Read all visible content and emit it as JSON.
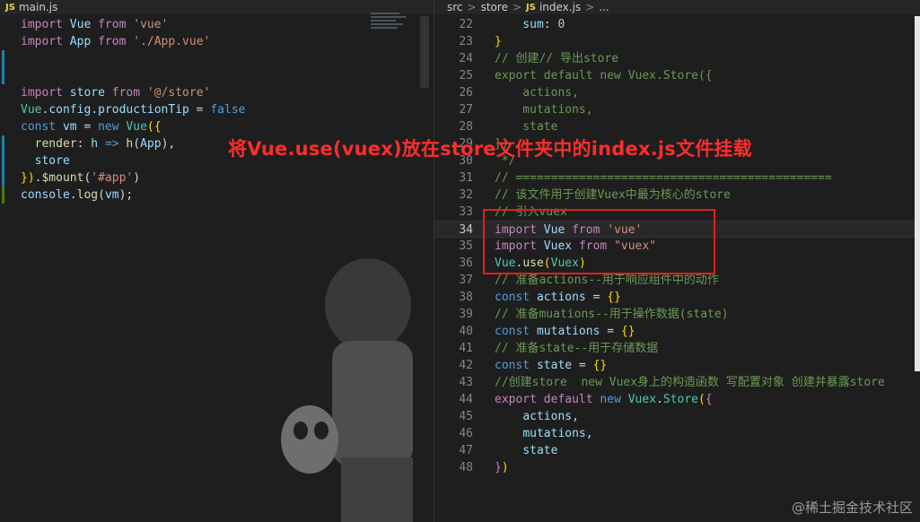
{
  "left_tab": {
    "badge": "JS",
    "filename": "main.js"
  },
  "breadcrumb": {
    "parts": [
      "src",
      "store"
    ],
    "badge": "JS",
    "file": "index.js",
    "sep": ">",
    "ellipsis": "..."
  },
  "annotation": "将Vue.use(vuex)放在store文件夹中的index.js文件挂载",
  "watermark": "@稀土掘金技术社区",
  "left_code": [
    "import Vue from 'vue'",
    "import App from './App.vue'",
    "",
    "",
    "import store from '@/store'",
    "Vue.config.productionTip = false",
    "const vm = new Vue({",
    "  render: h => h(App),",
    "  store",
    "}).$mount('#app')",
    "console.log(vm);"
  ],
  "right_code": [
    {
      "n": "22",
      "text": "    sum: 0"
    },
    {
      "n": "23",
      "text": "}"
    },
    {
      "n": "24",
      "text": "// 创建// 导出store"
    },
    {
      "n": "25",
      "text": "export default new Vuex.Store({"
    },
    {
      "n": "26",
      "text": "    actions,"
    },
    {
      "n": "27",
      "text": "    mutations,"
    },
    {
      "n": "28",
      "text": "    state"
    },
    {
      "n": "29",
      "text": "})"
    },
    {
      "n": "30",
      "text": " */"
    },
    {
      "n": "31",
      "text": "// ============================================="
    },
    {
      "n": "32",
      "text": "// 该文件用于创建Vuex中最为核心的store"
    },
    {
      "n": "33",
      "text": "// 引入vuex"
    },
    {
      "n": "34",
      "text": "import Vue from 'vue'"
    },
    {
      "n": "35",
      "text": "import Vuex from \"vuex\""
    },
    {
      "n": "36",
      "text": "Vue.use(Vuex)"
    },
    {
      "n": "37",
      "text": "// 准备actions--用于响应组件中的动作"
    },
    {
      "n": "38",
      "text": "const actions = {}"
    },
    {
      "n": "39",
      "text": "// 准备muations--用于操作数据(state)"
    },
    {
      "n": "40",
      "text": "const mutations = {}"
    },
    {
      "n": "41",
      "text": "// 准备state--用于存储数据"
    },
    {
      "n": "42",
      "text": "const state = {}"
    },
    {
      "n": "43",
      "text": "//创建store  new Vuex身上的构造函数 写配置对象 创建并暴露store"
    },
    {
      "n": "44",
      "text": "export default new Vuex.Store({"
    },
    {
      "n": "45",
      "text": "    actions,"
    },
    {
      "n": "46",
      "text": "    mutations,"
    },
    {
      "n": "47",
      "text": "    state"
    },
    {
      "n": "48",
      "text": "})"
    }
  ]
}
